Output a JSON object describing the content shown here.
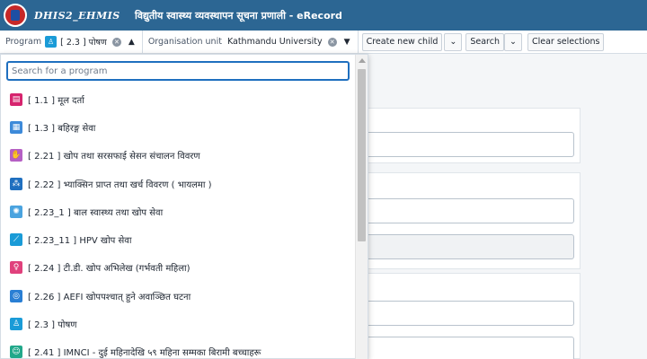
{
  "header": {
    "logo_text": "DHIS2_EHMIS",
    "title": "विद्युतीय स्वास्थ्य व्यवस्थापन सूचना प्रणाली - eRecord"
  },
  "selection_bar": {
    "program_label": "Program",
    "program_value": "[ 2.3 ] पोषण",
    "org_unit_label": "Organisation unit",
    "org_unit_value": "Kathmandu University",
    "create_new_child": "Create new child",
    "search": "Search",
    "clear_selections": "Clear selections"
  },
  "dropdown": {
    "search_placeholder": "Search for a program",
    "items": [
      {
        "label": "[ 1.1 ] मूल दर्ता",
        "icon": "register-book-icon",
        "color": "#d6246e"
      },
      {
        "label": "[ 1.3 ] बहिरङ्ग सेवा",
        "icon": "clipboard-icon",
        "color": "#3d8ad9"
      },
      {
        "label": "[ 2.21 ] खोप तथा सरसफाई सेसन संचालन विवरण",
        "icon": "hands-icon",
        "color": "#b55fc4"
      },
      {
        "label": "[ 2.22 ] भ्याक्सिन प्राप्त तथा खर्च विवरण ( भायलमा )",
        "icon": "molecule-icon",
        "color": "#1f6fbf"
      },
      {
        "label": "[ 2.23_1 ] बाल स्वास्थ्य तथा खोप सेवा",
        "icon": "virus-icon",
        "color": "#4aa3df"
      },
      {
        "label": "[ 2.23_11 ] HPV खोप सेवा",
        "icon": "syringe-icon",
        "color": "#1a9bd7"
      },
      {
        "label": "[ 2.24 ] टी.डी. खोप अभिलेख (गर्भवती महिला)",
        "icon": "pregnant-woman-icon",
        "color": "#e0417c"
      },
      {
        "label": "[ 2.26 ] AEFI खोपपश्चात् हुने अवाञ्छित घटना",
        "icon": "vaccine-reaction-icon",
        "color": "#2a7fd4"
      },
      {
        "label": "[ 2.3 ] पोषण",
        "icon": "child-nutrition-icon",
        "color": "#1a9bd7"
      },
      {
        "label": "[ 2.41 ] IMNCI - दुई महिनादेखि ५९ महिना सम्मका बिरामी बच्चाहरू",
        "icon": "children-icon",
        "color": "#22a88a"
      }
    ]
  }
}
